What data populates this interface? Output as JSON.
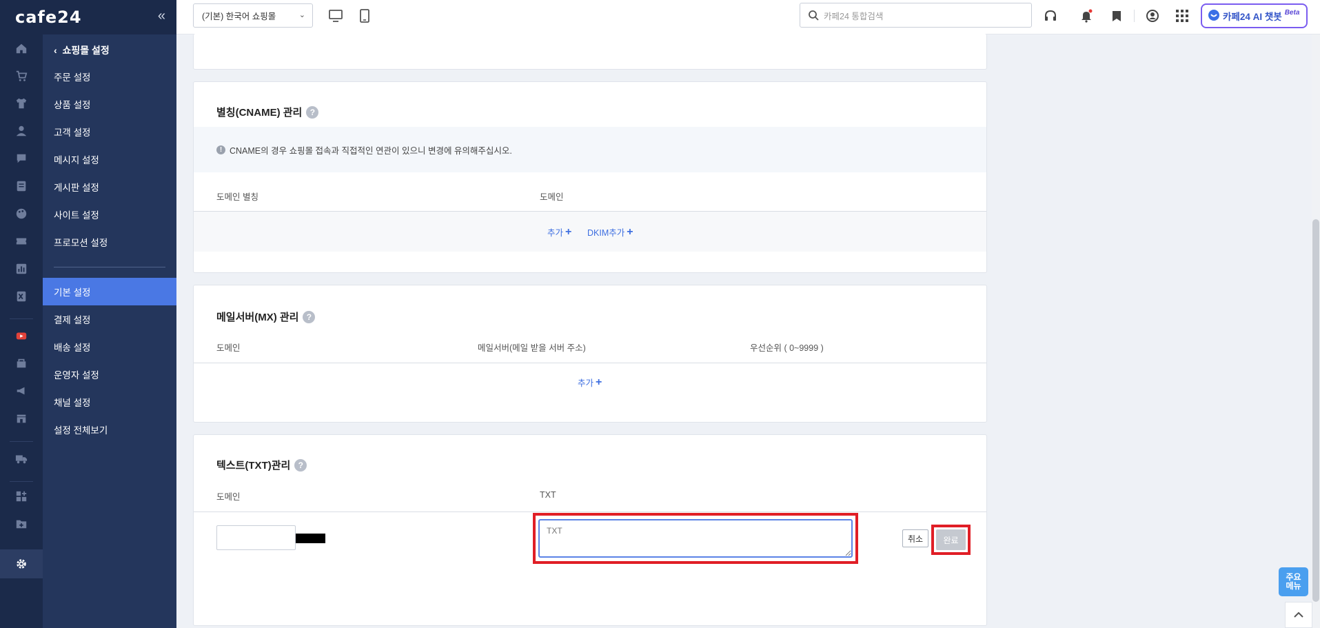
{
  "app": {
    "logo": "cafe24",
    "collapse_glyph": "«"
  },
  "topbar": {
    "store_select": "(기본) 한국어 쇼핑몰",
    "search_placeholder": "카페24 통합검색",
    "ai_chatbot_label": "카페24 AI 챗봇",
    "ai_chatbot_badge": "Beta"
  },
  "submenu": {
    "back_label": "쇼핑몰 설정",
    "items": [
      {
        "label": "주문 설정"
      },
      {
        "label": "상품 설정"
      },
      {
        "label": "고객 설정"
      },
      {
        "label": "메시지 설정"
      },
      {
        "label": "게시판 설정"
      },
      {
        "label": "사이트 설정"
      },
      {
        "label": "프로모션 설정"
      },
      {
        "label": "기본 설정",
        "active": true
      },
      {
        "label": "결제 설정"
      },
      {
        "label": "배송 설정"
      },
      {
        "label": "운영자 설정"
      },
      {
        "label": "채널 설정"
      },
      {
        "label": "설정 전체보기"
      }
    ]
  },
  "cname": {
    "title": "별칭(CNAME) 관리",
    "notice": "CNAME의 경우 쇼핑몰 접속과 직접적인 연관이 있으니 변경에 유의해주십시오.",
    "columns": [
      "도메인 별칭",
      "도메인"
    ],
    "add_label": "추가",
    "dkim_add_label": "DKIM추가"
  },
  "mx": {
    "title": "메일서버(MX) 관리",
    "columns": [
      "도메인",
      "메일서버(메일 받을 서버 주소)",
      "우선순위 ( 0~9999 )"
    ],
    "add_label": "추가"
  },
  "txt": {
    "title": "텍스트(TXT)관리",
    "columns": [
      "도메인",
      "TXT"
    ],
    "textarea_placeholder": "TXT",
    "cancel_label": "취소",
    "done_label": "완료"
  },
  "floating": {
    "main_menu_label": "주요\n메뉴"
  },
  "colors": {
    "sidebar": "#1b2a4a",
    "submenu": "#24365c",
    "active": "#4a78e4",
    "accent": "#3d6ee0",
    "highlight": "#e01e26"
  }
}
